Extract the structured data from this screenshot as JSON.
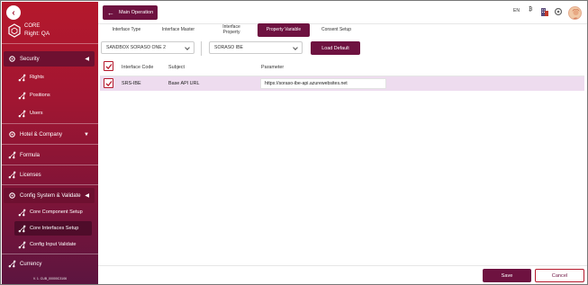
{
  "sidebar": {
    "app_name": "CORE",
    "right_label": "Right: QA",
    "security": {
      "label": "Security",
      "arrow": "◀"
    },
    "security_items": [
      {
        "label": "Rights"
      },
      {
        "label": "Positions"
      },
      {
        "label": "Users"
      }
    ],
    "hotel": {
      "label": "Hotel & Company",
      "arrow": "▼"
    },
    "formula": {
      "label": "Formula"
    },
    "licenses": {
      "label": "Licenses"
    },
    "config": {
      "label": "Config System & Validate",
      "arrow": "◀"
    },
    "config_items": [
      {
        "label": "Core Component Setup"
      },
      {
        "label": "Core Interfaces Setup"
      },
      {
        "label": "Config Input Validate"
      }
    ],
    "currency": {
      "label": "Currency"
    },
    "version": "V. 1. CUB_00000C3106"
  },
  "header": {
    "main_operation_label": "Main Operation",
    "language": "EN",
    "icons": [
      "bitcoin-icon",
      "building-icon",
      "gear-icon",
      "avatar"
    ]
  },
  "tabs": [
    {
      "label": "Interface Type",
      "active": false
    },
    {
      "label": "Interface Master",
      "active": false
    },
    {
      "label": "Interface Property",
      "active": false
    },
    {
      "label": "Property Variable",
      "active": true
    },
    {
      "label": "Consent Setup",
      "active": false
    }
  ],
  "filters": {
    "select1": "SANDBOX SORASO ONE 2",
    "select2": "SORASO IBE",
    "load_default_label": "Load Default"
  },
  "table": {
    "columns": [
      "Interface Code",
      "Subject",
      "Parameter"
    ],
    "rows": [
      {
        "checked": true,
        "interface_code": "SRS-IBE",
        "subject": "Base API URL",
        "parameter": "https://soraso-ibe-api.azurewebsites.net"
      }
    ]
  },
  "footer": {
    "save_label": "Save",
    "cancel_label": "Cancel"
  },
  "colors": {
    "primary": "#6e1240",
    "accent": "#b5182c",
    "row_highlight": "#eedcef"
  }
}
